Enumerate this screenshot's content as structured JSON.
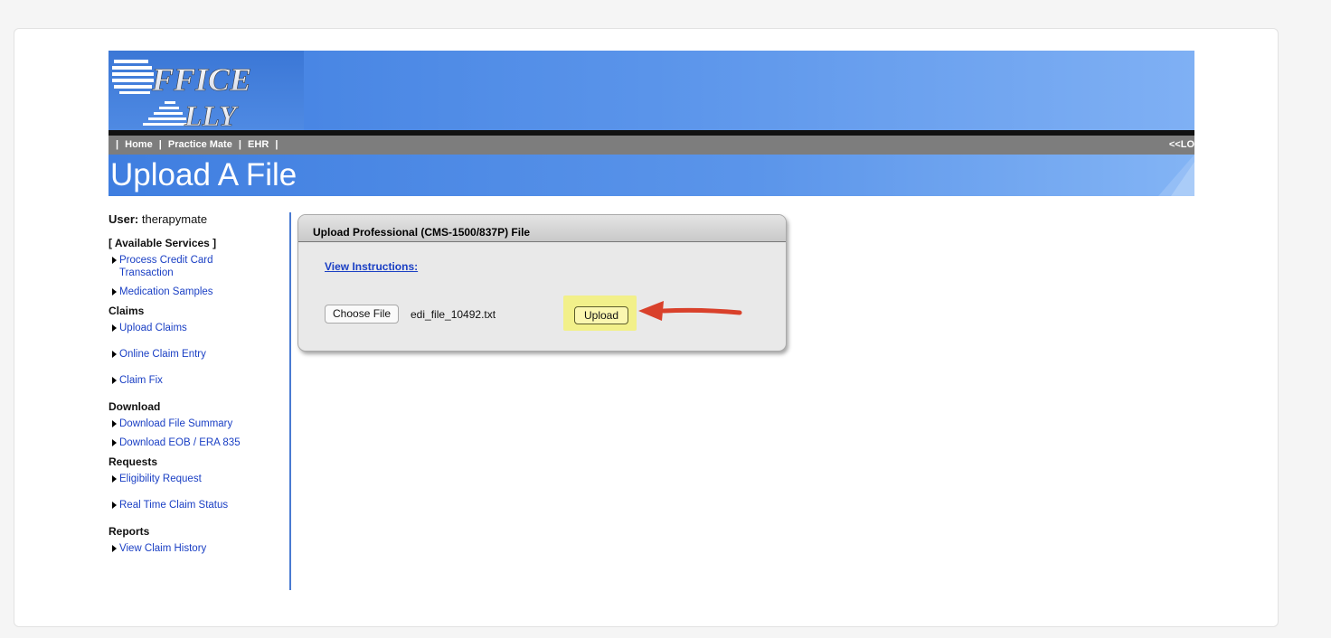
{
  "header": {
    "logo_line1": "FFICE",
    "logo_line2": "LLY"
  },
  "nav": {
    "home": "Home",
    "practice_mate": "Practice Mate",
    "ehr": "EHR",
    "sep": "|",
    "right_link": "<<LO"
  },
  "page": {
    "title": "Upload A File"
  },
  "sidebar": {
    "user_label": "User:",
    "user_value": "therapymate",
    "available_services": "[ Available Services ]",
    "services": [
      "Process Credit Card Transaction",
      "Medication Samples"
    ],
    "claims_heading": "Claims",
    "claims": [
      "Upload Claims",
      "Online Claim Entry",
      "Claim Fix"
    ],
    "download_heading": "Download",
    "download": [
      "Download File Summary",
      "Download EOB / ERA 835"
    ],
    "requests_heading": "Requests",
    "requests": [
      "Eligibility Request",
      "Real Time Claim Status"
    ],
    "reports_heading": "Reports",
    "reports": [
      "View Claim History"
    ]
  },
  "panel": {
    "title": "Upload Professional (CMS-1500/837P) File",
    "view_instructions": "View Instructions:",
    "choose_file_label": "Choose File",
    "file_name": "edi_file_10492.txt",
    "upload_label": "Upload"
  },
  "colors": {
    "link": "#1a3fc4",
    "highlight": "#f2f08a",
    "arrow": "#d9412b"
  }
}
